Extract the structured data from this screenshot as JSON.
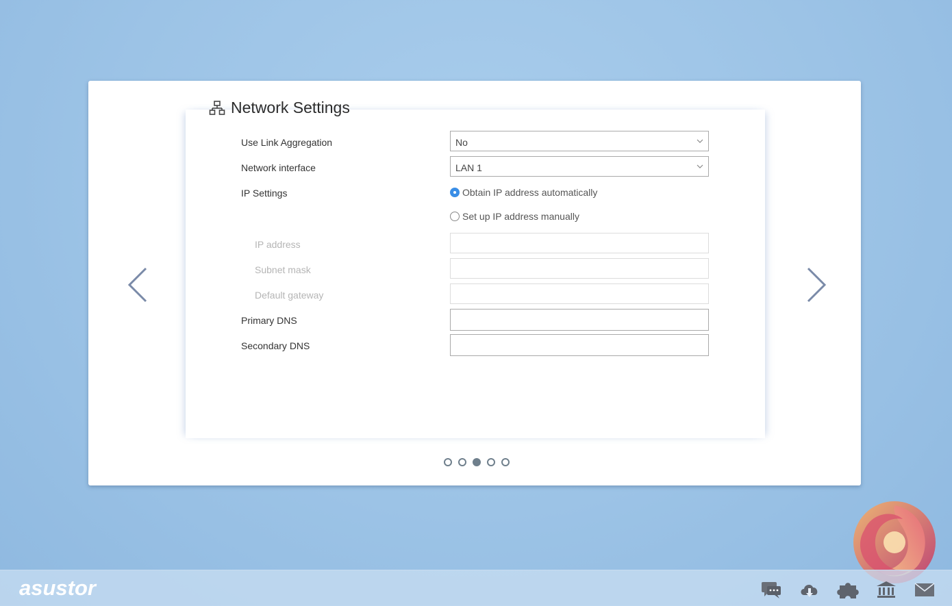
{
  "header": {
    "title": "Network Settings",
    "icon": "network-icon"
  },
  "form": {
    "link_aggregation": {
      "label": "Use Link Aggregation",
      "value": "No"
    },
    "network_interface": {
      "label": "Network interface",
      "value": "LAN 1"
    },
    "ip_settings": {
      "label": "IP Settings",
      "options": [
        {
          "label": "Obtain IP address automatically",
          "selected": true
        },
        {
          "label": "Set up IP address manually",
          "selected": false
        }
      ]
    },
    "ip_address": {
      "label": "IP address",
      "value": ""
    },
    "subnet_mask": {
      "label": "Subnet mask",
      "value": ""
    },
    "default_gateway": {
      "label": "Default gateway",
      "value": ""
    },
    "primary_dns": {
      "label": "Primary DNS",
      "value": ""
    },
    "secondary_dns": {
      "label": "Secondary DNS",
      "value": ""
    }
  },
  "pagination": {
    "total": 5,
    "current": 3
  },
  "taskbar": {
    "logo": "asustor",
    "icons": [
      "chat-icon",
      "cloud-download-icon",
      "plugin-icon",
      "bank-icon",
      "mail-icon"
    ]
  },
  "colors": {
    "accent": "#3a8ee6",
    "background": "#9cc3e6",
    "arrow": "#7a8aa8"
  }
}
